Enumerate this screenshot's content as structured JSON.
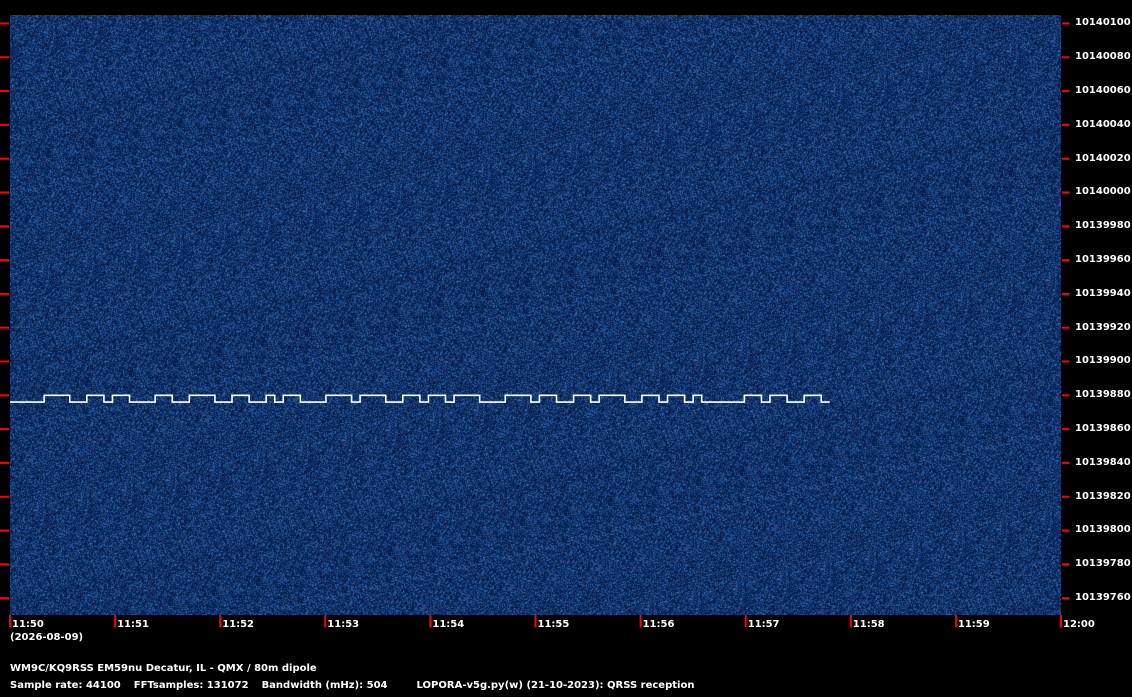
{
  "colors": {
    "background": "#000000",
    "waterfall": "#0c2350",
    "tick": "#ff0000",
    "signal": "#ffffff",
    "text": "#ffffff"
  },
  "chart_data": {
    "type": "spectrogram",
    "x_unit": "time (HH:MM)",
    "y_unit": "frequency (Hz)",
    "xlim": [
      "11:50",
      "12:00"
    ],
    "ylim": [
      10139750,
      10140105
    ],
    "x_ticks": [
      "11:50",
      "11:51",
      "11:52",
      "11:53",
      "11:54",
      "11:55",
      "11:56",
      "11:57",
      "11:58",
      "11:59",
      "12:00"
    ],
    "y_ticks": [
      10140100,
      10140080,
      10140060,
      10140040,
      10140020,
      10140000,
      10139980,
      10139960,
      10139940,
      10139920,
      10139900,
      10139880,
      10139860,
      10139840,
      10139820,
      10139800,
      10139780,
      10139760
    ],
    "signal": {
      "description": "FSK QRSS trace",
      "low_hz": 10139876,
      "high_hz": 10139880,
      "start": "11:50",
      "end": "11:57.8",
      "pattern": [
        0,
        0,
        0,
        0,
        1,
        1,
        1,
        0,
        0,
        1,
        1,
        0,
        1,
        1,
        0,
        0,
        0,
        1,
        1,
        0,
        0,
        1,
        1,
        1,
        0,
        0,
        1,
        1,
        0,
        0,
        1,
        0,
        1,
        1,
        0,
        0,
        0,
        1,
        1,
        1,
        0,
        1,
        1,
        1,
        0,
        0,
        1,
        1,
        0,
        1,
        1,
        0,
        1,
        1,
        1,
        0,
        0,
        0,
        1,
        1,
        1,
        0,
        1,
        1,
        0,
        0,
        1,
        1,
        0,
        1,
        1,
        1,
        0,
        0,
        1,
        1,
        0,
        1,
        1,
        0,
        1,
        0,
        0,
        0,
        0,
        0,
        1,
        1,
        0,
        1,
        1,
        0,
        0,
        1,
        1,
        0
      ]
    }
  },
  "date_label": "(2026-08-09)",
  "info": {
    "line1": "WM9C/KQ9RSS EM59nu Decatur, IL - QMX / 80m dipole",
    "sample_rate": "Sample rate: 44100",
    "fft_samples": "FFTsamples: 131072",
    "bandwidth": "Bandwidth (mHz): 504",
    "software": "LOPORA-v5g.py(w) (21-10-2023): QRSS reception"
  }
}
